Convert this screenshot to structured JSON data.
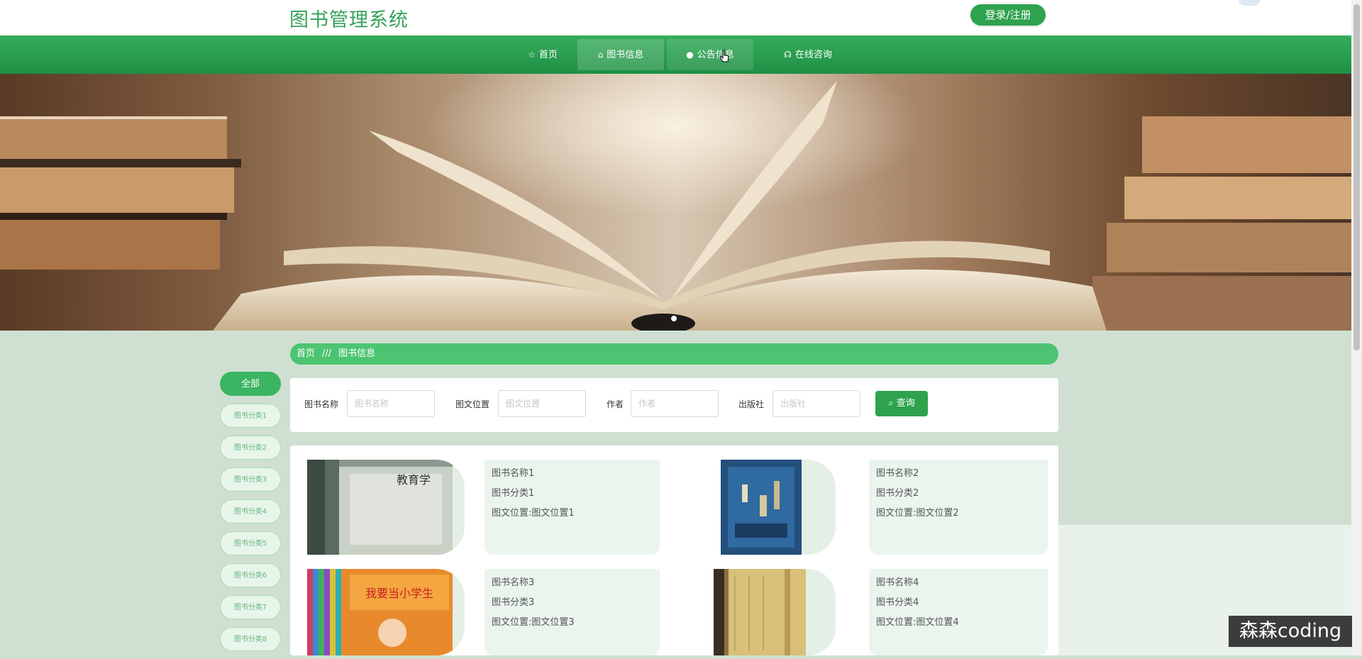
{
  "header": {
    "site_title": "图书管理系统",
    "login_label": "登录/注册"
  },
  "nav": {
    "items": [
      {
        "label": "首页",
        "icon": "star-icon"
      },
      {
        "label": "图书信息",
        "icon": "home-icon"
      },
      {
        "label": "公告信息",
        "icon": "info-circle-icon"
      },
      {
        "label": "在线咨询",
        "icon": "headset-icon"
      }
    ],
    "active_index": 1
  },
  "breadcrumb": {
    "home": "首页",
    "separator": "///",
    "current": "图书信息"
  },
  "categories": [
    "全部",
    "图书分类1",
    "图书分类2",
    "图书分类3",
    "图书分类4",
    "图书分类5",
    "图书分类6",
    "图书分类7",
    "图书分类8"
  ],
  "search": {
    "fields": [
      {
        "label": "图书名称",
        "placeholder": "图书名称"
      },
      {
        "label": "图文位置",
        "placeholder": "图文位置"
      },
      {
        "label": "作者",
        "placeholder": "作者"
      },
      {
        "label": "出版社",
        "placeholder": "出版社"
      }
    ],
    "button_label": "查询",
    "button_icon": "search-icon"
  },
  "books": [
    {
      "name": "图书名称1",
      "category": "图书分类1",
      "location": "图文位置:图文位置1",
      "cover_text": "教育学",
      "cover_color": "#9aa59c"
    },
    {
      "name": "图书名称2",
      "category": "图书分类2",
      "location": "图文位置:图文位置2",
      "cover_text": "",
      "cover_color": "#2a5a8a"
    },
    {
      "name": "图书名称3",
      "category": "图书分类3",
      "location": "图文位置:图文位置3",
      "cover_text": "我要当小学生",
      "cover_color": "#e88a2c"
    },
    {
      "name": "图书名称4",
      "category": "图书分类4",
      "location": "图文位置:图文位置4",
      "cover_text": "",
      "cover_color": "#d9c07a"
    }
  ],
  "watermark": "森森coding",
  "colors": {
    "brand_green": "#2fa24e",
    "nav_green": "#23954a",
    "page_bg": "#cfe0d2"
  }
}
